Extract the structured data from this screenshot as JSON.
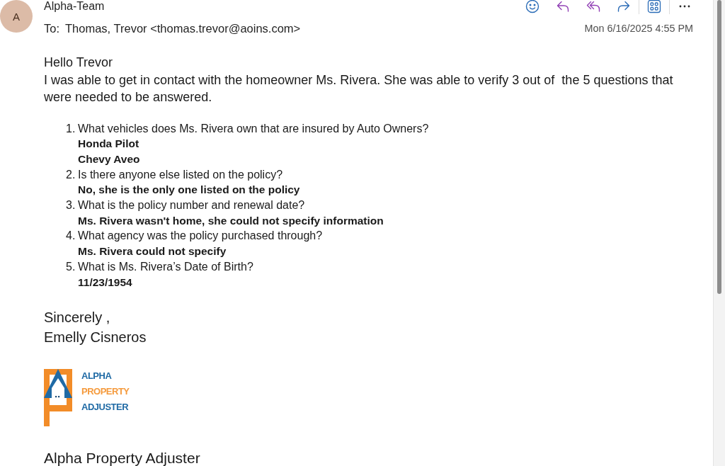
{
  "header": {
    "avatar_initial": "A",
    "sender": "Alpha-Team",
    "to_label": "To:",
    "recipient": "Thomas, Trevor <thomas.trevor@aoins.com>",
    "date": "Mon 6/16/2025 4:55 PM"
  },
  "body": {
    "greeting": "Hello Trevor",
    "paragraph": "I was able to get in contact with the homeowner Ms. Rivera. She was able to verify 3 out of  the 5 questions that were needed to be answered.",
    "questions": [
      {
        "number": "1.",
        "question": "What vehicles does Ms. Rivera own that are insured by Auto Owners?",
        "answers": [
          "Honda Pilot",
          "Chevy Aveo"
        ]
      },
      {
        "number": "2.",
        "question": "Is there anyone else listed on the policy?",
        "answers": [
          "No, she is the only one listed on the policy"
        ]
      },
      {
        "number": "3.",
        "question": "What is the policy number and renewal date?",
        "answers": [
          "Ms. Rivera wasn't home, she could not specify information"
        ]
      },
      {
        "number": "4.",
        "question": "What agency was the policy purchased through?",
        "answers": [
          "Ms. Rivera could not specify"
        ]
      },
      {
        "number": "5.",
        "question": "What is Ms. Rivera’s Date of Birth?",
        "answers": [
          "11/23/1954"
        ]
      }
    ],
    "closing": "Sincerely ,",
    "signature_name": "Emelly Cisneros",
    "logo": {
      "lines": [
        {
          "text": "ALPHA",
          "color": "#1f6aa5"
        },
        {
          "text": "PROPERTY",
          "color": "#f59a3c"
        },
        {
          "text": "ADJUSTER",
          "color": "#1f6aa5"
        }
      ]
    },
    "company": "Alpha Property Adjuster"
  }
}
